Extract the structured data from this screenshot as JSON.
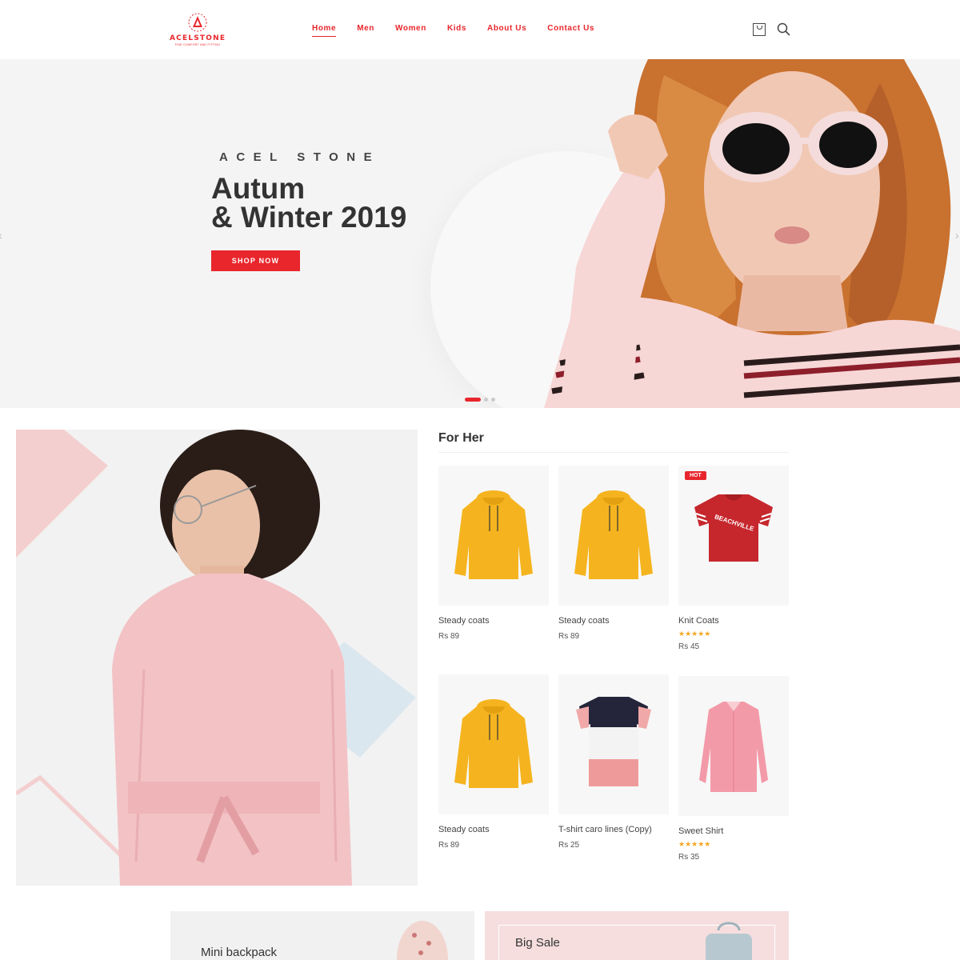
{
  "header": {
    "logo_name": "ACELSTONE",
    "logo_tagline": "FINE COMFORT AND FITTING",
    "nav": [
      {
        "label": "Home"
      },
      {
        "label": "Men"
      },
      {
        "label": "Women"
      },
      {
        "label": "Kids"
      },
      {
        "label": "About Us"
      },
      {
        "label": "Contact Us"
      }
    ],
    "icons": [
      "shopping-bag-icon",
      "search-icon"
    ]
  },
  "hero": {
    "brand": "ACEL STONE",
    "title_line1": "Autum",
    "title_line2": "& Winter 2019",
    "cta": "SHOP NOW",
    "slide_count": 3,
    "active_slide": 1
  },
  "for_her": {
    "title": "For Her",
    "products": [
      {
        "name": "Steady coats",
        "price": "Rs 89",
        "image": "yellow-hoodie",
        "badge": "",
        "rating": 0
      },
      {
        "name": "Steady coats",
        "price": "Rs 89",
        "image": "yellow-hoodie",
        "badge": "",
        "rating": 0
      },
      {
        "name": "Knit Coats",
        "price": "Rs 45",
        "image": "red-tshirt",
        "badge": "HOT",
        "rating": 5
      },
      {
        "name": "Steady coats",
        "price": "Rs 89",
        "image": "yellow-hoodie",
        "badge": "",
        "rating": 0
      },
      {
        "name": "T-shirt caro lines (Copy)",
        "price": "Rs 25",
        "image": "striped-tshirt",
        "badge": "",
        "rating": 0
      },
      {
        "name": "Sweet Shirt",
        "price": "Rs 35",
        "image": "pink-shirt",
        "badge": "",
        "rating": 5
      }
    ],
    "tshirt_print": "BEACHVILLE"
  },
  "banners": {
    "left_title": "Mini backpack",
    "right_title": "Big Sale"
  },
  "colors": {
    "accent": "#e8262c",
    "hoodie": "#f5b41f",
    "pink": "#f3c4c4",
    "star": "#f5a623"
  }
}
